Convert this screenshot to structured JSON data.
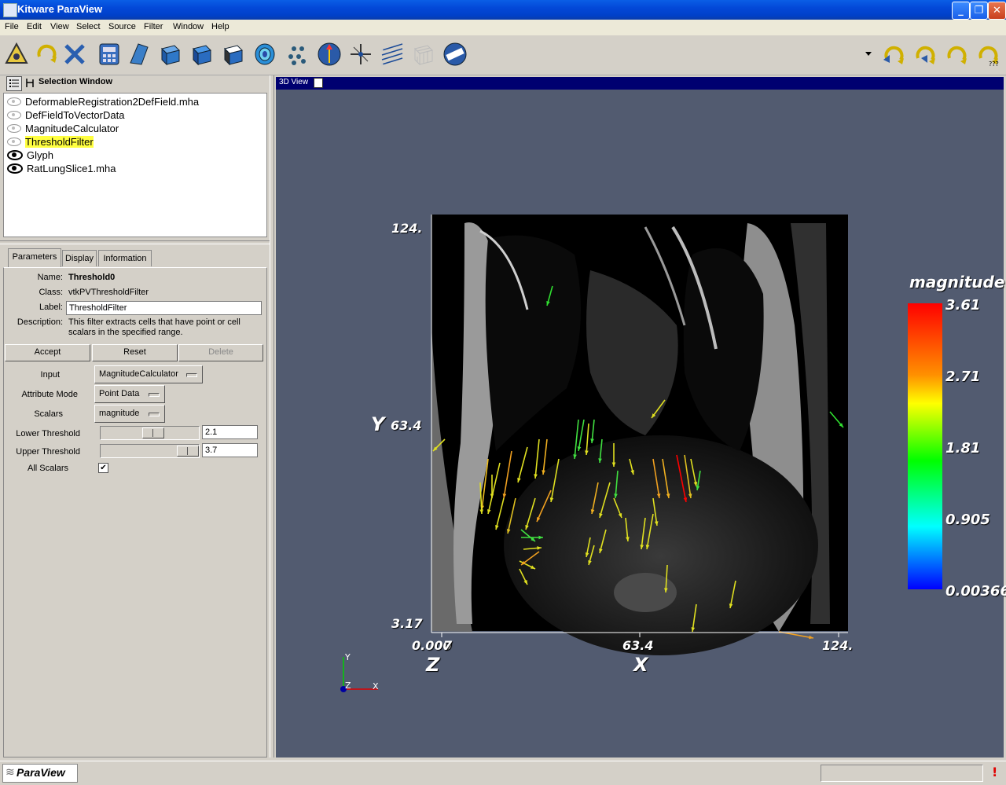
{
  "window": {
    "title": "Kitware ParaView"
  },
  "menu": [
    "File",
    "Edit",
    "View",
    "Select",
    "Source",
    "Filter",
    "Window",
    "Help"
  ],
  "toolbar": {
    "left_icons": [
      "reset-camera-icon",
      "rotate-icon",
      "interact-icon",
      "calculator-icon",
      "cut-icon",
      "clip-icon",
      "threshold-icon",
      "extract-grid-icon",
      "contour-icon",
      "glyph-icon",
      "stream-tracer-icon",
      "warp-icon",
      "probe-icon",
      "ruler-icon"
    ],
    "right_icons": [
      "undo-icon",
      "undo-camera-icon",
      "redo-icon",
      "help-icon"
    ]
  },
  "selection_window": {
    "title": "Selection Window",
    "items": [
      {
        "label": "DeformableRegistration2DefField.mha",
        "visible": false,
        "selected": false
      },
      {
        "label": "DefFieldToVectorData",
        "visible": false,
        "selected": false
      },
      {
        "label": "MagnitudeCalculator",
        "visible": false,
        "selected": false
      },
      {
        "label": "ThresholdFilter",
        "visible": false,
        "selected": true
      },
      {
        "label": "Glyph",
        "visible": true,
        "selected": false
      },
      {
        "label": "RatLungSlice1.mha",
        "visible": true,
        "selected": false
      }
    ]
  },
  "tabs": {
    "parameters": "Parameters",
    "display": "Display",
    "information": "Information"
  },
  "params": {
    "name_label": "Name:",
    "name": "Threshold0",
    "class_label": "Class:",
    "class": "vtkPVThresholdFilter",
    "label_label": "Label:",
    "label_value": "ThresholdFilter",
    "description_label": "Description:",
    "description_line1": "This filter extracts cells that have point or cell",
    "description_line2": "scalars in the specified range.",
    "accept": "Accept",
    "reset": "Reset",
    "delete": "Delete",
    "input_label": "Input",
    "input_value": "MagnitudeCalculator",
    "attribute_label": "Attribute Mode",
    "attribute_value": "Point Data",
    "scalars_label": "Scalars",
    "scalars_value": "magnitude",
    "lower_label": "Lower Threshold",
    "lower_value": "2.1",
    "lower_slider": 0.55,
    "upper_label": "Upper Threshold",
    "upper_value": "3.7",
    "upper_slider": 1.0,
    "all_scalars_label": "All Scalars",
    "all_scalars_checked": true
  },
  "view": {
    "title": "3D View",
    "y_ticks": [
      "124.",
      "63.4",
      "3.17"
    ],
    "y_label": "Y",
    "x_ticks": [
      "0.000",
      "63.4",
      "124."
    ],
    "x_overlap": "7",
    "z_label": "Z",
    "x_label": "X",
    "triad": {
      "y": "Y",
      "z": "Z",
      "x": "X"
    },
    "legend": {
      "title": "magnitude",
      "ticks": [
        "3.61",
        "2.71",
        "1.81",
        "0.905",
        "0.00366"
      ],
      "colors": {
        "high": "#ff0000",
        "mid_high": "#ffff00",
        "mid": "#00ff00",
        "mid_low": "#00ffff",
        "low": "#0000ff"
      }
    }
  },
  "status": {
    "app_name": "ParaView"
  }
}
